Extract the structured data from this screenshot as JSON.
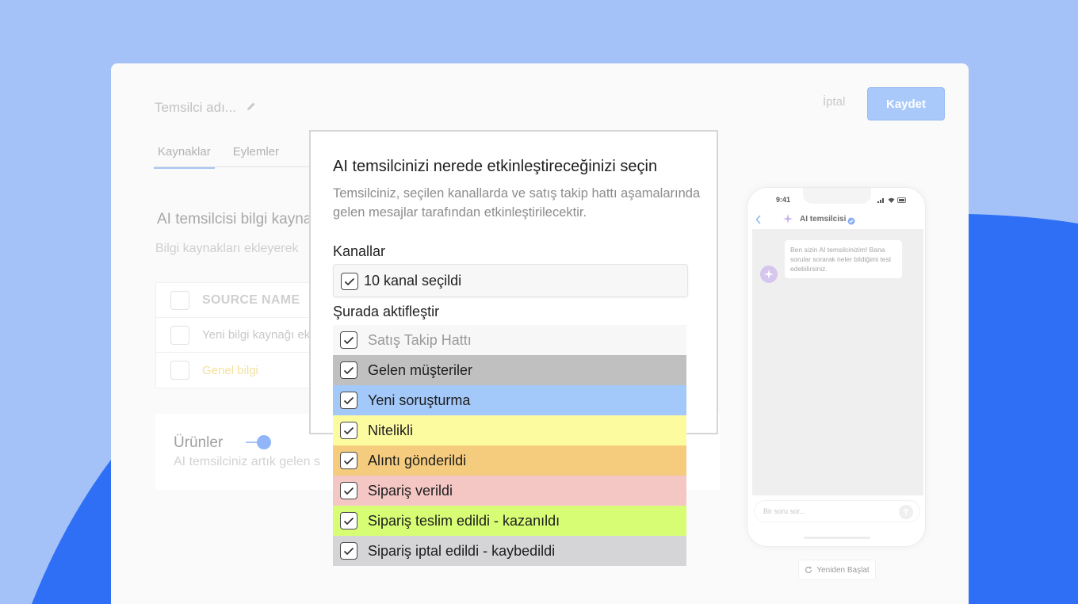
{
  "header": {
    "agent_name_placeholder": "Temsilci adı...",
    "cancel_label": "İptal",
    "save_label": "Kaydet"
  },
  "tabs": [
    {
      "label": "Kaynaklar",
      "active": true
    },
    {
      "label": "Eylemler",
      "active": false
    }
  ],
  "knowledge": {
    "title": "AI temsilcisi bilgi kaynakları",
    "subtitle": "Bilgi kaynakları ekleyerek",
    "table": {
      "header": "SOURCE NAME",
      "rows": [
        "Yeni bilgi kaynağı ekle",
        "Genel bilgi"
      ]
    }
  },
  "products": {
    "title": "Ürünler",
    "toggle_on": true,
    "subtitle": "AI temsilciniz artık gelen s"
  },
  "modal": {
    "title": "AI temsilcinizi nerede etkinleştireceğinizi seçin",
    "description": "Temsilciniz, seçilen kanallarda ve satış takip hattı aşamalarında gelen mesajlar tarafından etkinleştirilecektir.",
    "channels_label": "Kanallar",
    "channels_selected": "10 kanal seçildi",
    "activate_label": "Şurada aktifleştir"
  },
  "pipeline": {
    "header": "Satış Takip Hattı",
    "stages": [
      {
        "label": "Gelen müşteriler",
        "color": "#c0c0c0",
        "checked": true
      },
      {
        "label": "Yeni soruşturma",
        "color": "#a3c8fa",
        "checked": true
      },
      {
        "label": "Nitelikli",
        "color": "#fdfba0",
        "checked": true
      },
      {
        "label": "Alıntı gönderildi",
        "color": "#f5cc7d",
        "checked": true
      },
      {
        "label": "Sipariş verildi",
        "color": "#f4c7c5",
        "checked": true
      },
      {
        "label": "Sipariş teslim edildi - kazanıldı",
        "color": "#d6fd74",
        "checked": true
      },
      {
        "label": "Sipariş iptal edildi - kaybedildi",
        "color": "#d5d5d7",
        "checked": true
      }
    ]
  },
  "phone": {
    "time": "9:41",
    "title": "AI temsilcisi",
    "message": "Ben sizin AI temsilcinizim! Bana sorular sorarak neler bildiğimi test edebilirsiniz.",
    "input_placeholder": "Bir soru sor...",
    "restart_label": "Yeniden Başlat"
  },
  "colors": {
    "background": "#a4c1f8",
    "wave": "#2e6ff5",
    "accent": "#a9c9fa"
  }
}
